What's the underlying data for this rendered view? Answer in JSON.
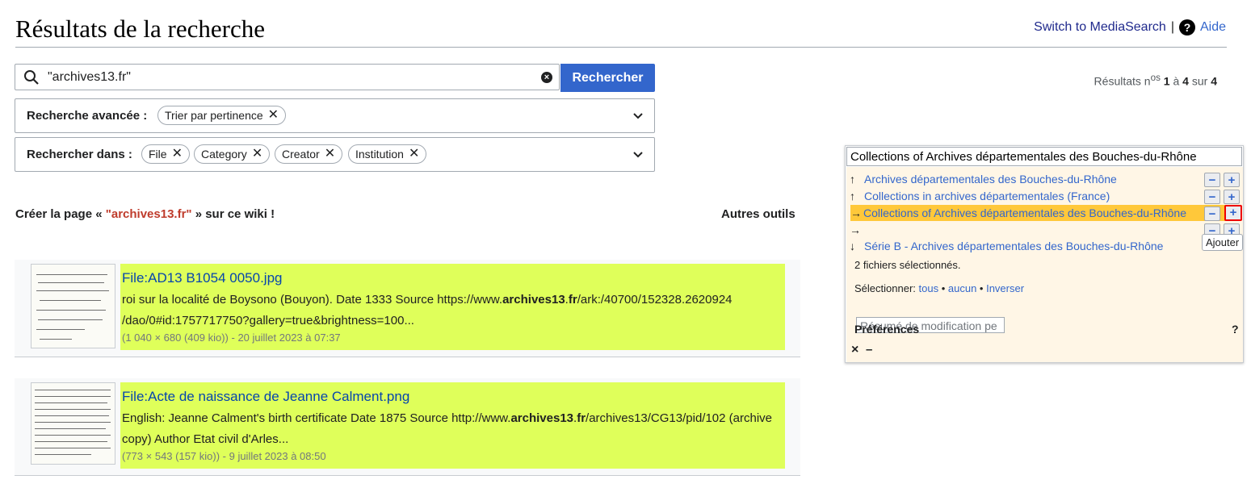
{
  "page": {
    "title": "Résultats de la recherche",
    "switch_link": "Switch to MediaSearch",
    "separator": "|",
    "help_label": "Aide"
  },
  "search": {
    "query": "\"archives13.fr\"",
    "button": "Rechercher",
    "results_prefix": "Résultats n",
    "results_sup": "os",
    "results_from": "1",
    "results_a": "à",
    "results_to": "4",
    "results_sur": "sur",
    "results_total": "4"
  },
  "advanced": {
    "label": "Recherche avancée :",
    "chips": [
      "Trier par pertinence"
    ]
  },
  "namespaces": {
    "label": "Rechercher dans :",
    "chips": [
      "File",
      "Category",
      "Creator",
      "Institution"
    ]
  },
  "create": {
    "prefix": "Créer la page « ",
    "link": "\"archives13.fr\"",
    "suffix": " » sur ce wiki !",
    "other_tools": "Autres outils"
  },
  "results": [
    {
      "title": "File:AD13 B1054 0050.jpg",
      "snippet_1": "roi sur la localité de Boysono (Bouyon). Date 1333 Source https://www.",
      "snippet_bold": "archives13",
      "snippet_2": ".",
      "snippet_bold2": "fr",
      "snippet_3": "/ark:/40700/152328.2620924 /dao/0#id:1757717750?gallery=true&brightness=100...",
      "meta": "(1 040 × 680 (409 kio)) - 20 juillet 2023 à 07:37"
    },
    {
      "title": "File:Acte de naissance de Jeanne Calment.png",
      "snippet_1": "English: Jeanne Calment's birth certificate Date 1875 Source http://www.",
      "snippet_bold": "archives13",
      "snippet_2": ".",
      "snippet_bold2": "fr",
      "snippet_3": "/archives13/CG13/pid/102 (archive copy) Author Etat civil d'Arles...",
      "meta": "(773 × 543 (157 kio)) - 9 juillet 2023 à 08:50"
    }
  ],
  "cat_panel": {
    "input": "Collections of Archives départementales des Bouches-du-Rhône",
    "rows": [
      {
        "arrow": "↑",
        "label": "Archives départementales des Bouches-du-Rhône"
      },
      {
        "arrow": "↑",
        "label": "Collections in archives départementales (France)"
      },
      {
        "arrow": "→",
        "label": "Collections of Archives départementales des Bouches-du-Rhône"
      },
      {
        "arrow": "→",
        "label": ""
      },
      {
        "arrow": "↓",
        "label": "Série B - Archives départementales des Bouches-du-Rhône"
      }
    ],
    "selected_count": "2 fichiers sélectionnés.",
    "select_label": "Sélectionner:",
    "select_all": "tous",
    "select_none": "aucun",
    "select_invert": "Inverser",
    "summary_placeholder": "Résumé de modification pe",
    "preferences": "Préférences",
    "help": "?",
    "close": "×",
    "minimize": "–",
    "tooltip": "Ajouter",
    "minus": "−",
    "plus": "+"
  }
}
